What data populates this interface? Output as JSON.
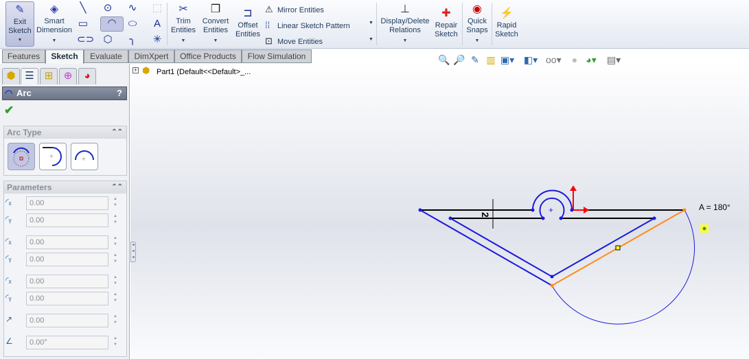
{
  "toolbar": {
    "exit_sketch": "Exit Sketch",
    "smart_dimension": "Smart Dimension",
    "trim_entities": "Trim Entities",
    "convert_entities": "Convert Entities",
    "offset_entities": "Offset Entities",
    "mirror_entities": "Mirror Entities",
    "linear_sketch_pattern": "Linear Sketch Pattern",
    "move_entities": "Move Entities",
    "display_delete_relations": "Display/Delete Relations",
    "repair_sketch": "Repair Sketch",
    "quick_snaps": "Quick Snaps",
    "rapid_sketch": "Rapid Sketch"
  },
  "tabs": [
    {
      "label": "Features"
    },
    {
      "label": "Sketch",
      "active": true
    },
    {
      "label": "Evaluate"
    },
    {
      "label": "DimXpert"
    },
    {
      "label": "Office Products"
    },
    {
      "label": "Flow Simulation"
    }
  ],
  "feature_tree": {
    "root": "Part1  (Default<<Default>_..."
  },
  "property_manager": {
    "title": "Arc",
    "help": "?",
    "arc_type": {
      "label": "Arc Type",
      "options": [
        "centerpoint-arc",
        "tangent-arc",
        "3-point-arc"
      ],
      "selected": "centerpoint-arc"
    },
    "parameters": {
      "label": "Parameters",
      "fields": [
        {
          "icon": "center-x-icon",
          "value": "0.00"
        },
        {
          "icon": "center-y-icon",
          "value": "0.00"
        },
        {
          "icon": "start-x-icon",
          "value": "0.00"
        },
        {
          "icon": "start-y-icon",
          "value": "0.00"
        },
        {
          "icon": "end-x-icon",
          "value": "0.00"
        },
        {
          "icon": "end-y-icon",
          "value": "0.00"
        },
        {
          "icon": "radius-icon",
          "value": "0.00"
        },
        {
          "icon": "angle-icon",
          "value": "0.00°"
        }
      ]
    }
  },
  "sketch": {
    "dimension": "2",
    "arc_angle": "A = 180°",
    "colors": {
      "defined": "#000000",
      "under_defined": "#1a1adc",
      "preview": "#ff8c1a",
      "origin": "#ff0000"
    }
  }
}
